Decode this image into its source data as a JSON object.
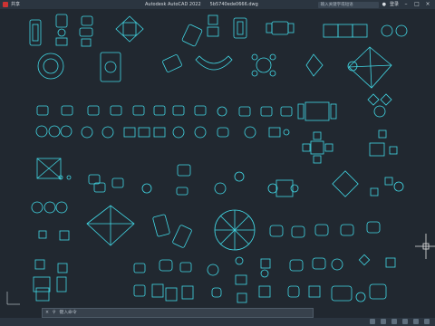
{
  "titlebar": {
    "menu_label": "共享",
    "app_name": "Autodesk AutoCAD 2022",
    "file_name": "5b5740ede0666.dwg",
    "search_placeholder": "输入关键字或短语",
    "user_label": "登录"
  },
  "command": {
    "prompt": "键入命令"
  },
  "colors": {
    "background": "#212830",
    "linework": "#42d9e6",
    "crosshair": "#e6e6e6"
  }
}
